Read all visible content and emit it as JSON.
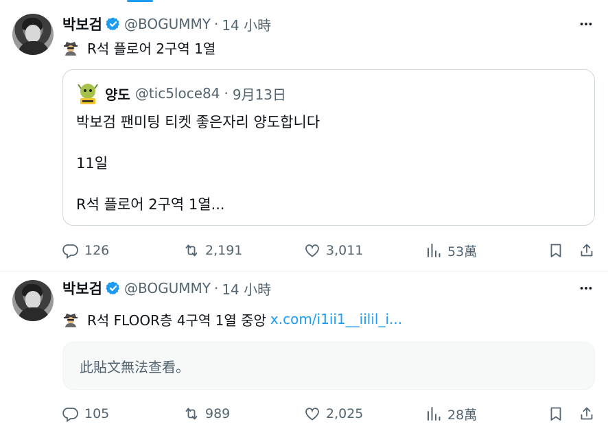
{
  "tweets": [
    {
      "author": {
        "name": "박보검",
        "handle": "@BOGUMMY",
        "time": "14 小時"
      },
      "text": "R석 플로어 2구역 1열",
      "emoji": "detective-emoji",
      "quote": {
        "name": "양도",
        "handle": "@tic5loce84",
        "time": "9月13日",
        "lines": [
          "박보검 팬미팅 티켓 좋은자리 양도합니다",
          "11일",
          "R석 플로어 2구역 1열..."
        ]
      },
      "stats": {
        "replies": "126",
        "retweets": "2,191",
        "likes": "3,011",
        "views": "53萬"
      }
    },
    {
      "author": {
        "name": "박보검",
        "handle": "@BOGUMMY",
        "time": "14 小時"
      },
      "text": "R석 FLOOR층 4구역 1열 중앙",
      "link": "x.com/i1ii1__iilil_i...",
      "emoji": "detective-emoji",
      "unavailable": "此貼文無法查看。",
      "stats": {
        "replies": "105",
        "retweets": "989",
        "likes": "2,025",
        "views": "28萬"
      }
    }
  ],
  "separator": "·",
  "colors": {
    "accent": "#1d9bf0",
    "muted": "#536471",
    "text": "#0f1419",
    "border": "#cfd9de"
  }
}
